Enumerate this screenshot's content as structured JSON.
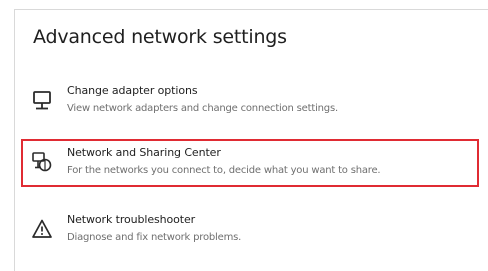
{
  "page": {
    "title": "Advanced network settings"
  },
  "items": [
    {
      "title": "Change adapter options",
      "description": "View network adapters and change connection settings.",
      "icon": "monitor-network-icon"
    },
    {
      "title": "Network and Sharing Center",
      "description": "For the networks you connect to, decide what you want to share.",
      "icon": "sharing-center-icon",
      "highlighted": true,
      "highlight_color": "#e02b33"
    },
    {
      "title": "Network troubleshooter",
      "description": "Diagnose and fix network problems.",
      "icon": "warning-triangle-icon"
    }
  ]
}
